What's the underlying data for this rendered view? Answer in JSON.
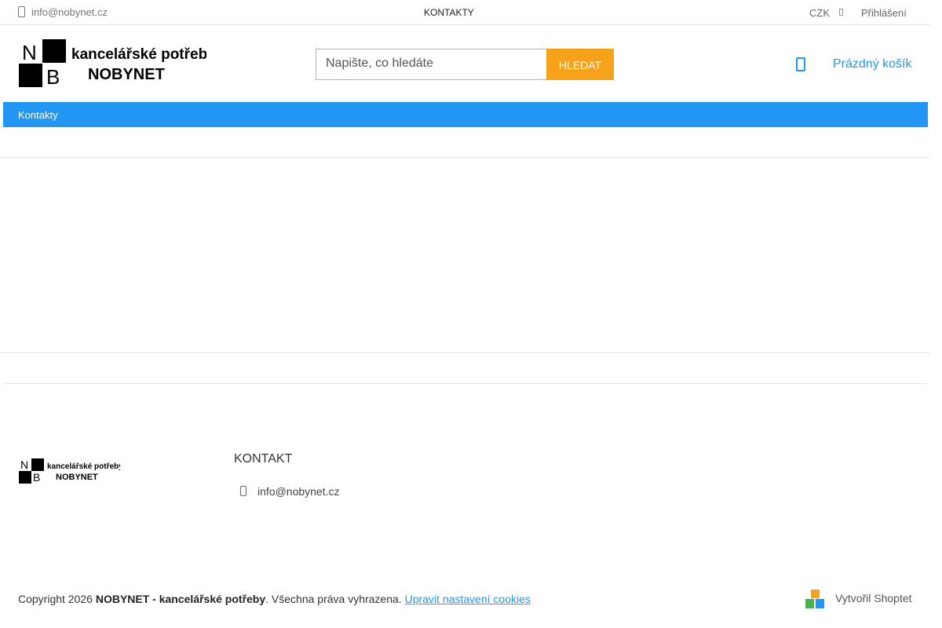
{
  "topbar": {
    "email": "info@nobynet.cz",
    "contacts_link": "KONTAKTY",
    "currency": "CZK",
    "login": "Přihlášení"
  },
  "header": {
    "logo": {
      "letter_n": "N",
      "letter_b": "B",
      "line1": "kancelářské potřeby",
      "line2": "NOBYNET"
    },
    "search": {
      "placeholder": "Napište, co hledáte",
      "button": "HLEDAT"
    },
    "cart": {
      "label": "Prázdný košík"
    }
  },
  "nav": {
    "items": [
      {
        "label": "Kontakty"
      }
    ]
  },
  "footer": {
    "logo": {
      "letter_n": "N",
      "letter_b": "B",
      "line1": "kancelářské potřeby",
      "line2": "NOBYNET"
    },
    "contact_heading": "KONTAKT",
    "email": "info@nobynet.cz",
    "copyright_prefix": "Copyright 2026 ",
    "company": "NOBYNET - kancelářské potřeby",
    "rights": ". Všechna práva vyhrazena. ",
    "cookies_link": "Upravit nastavení cookies",
    "shoptet": "Vytvořil Shoptet"
  },
  "colors": {
    "accent": "#2196f3",
    "search_button": "#f7a21b"
  },
  "icons": {
    "top_email": "envelope-icon",
    "top_currency_caret": "chevron-down-icon",
    "cart": "shopping-cart-icon",
    "footer_email": "envelope-icon",
    "shoptet": "shoptet-logo-icon"
  }
}
